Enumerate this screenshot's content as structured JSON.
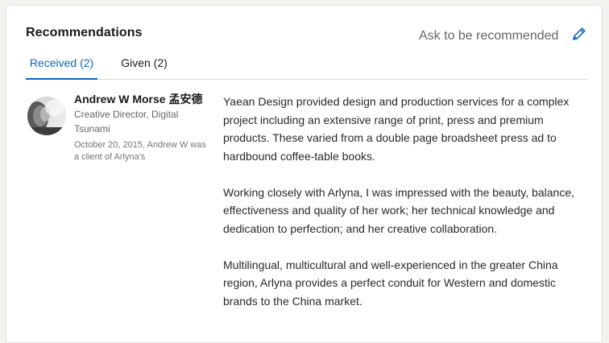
{
  "section": {
    "title": "Recommendations",
    "ask_label": "Ask to be recommended",
    "edit_icon": "pencil-icon",
    "accent_color": "#0a66c2"
  },
  "tabs": [
    {
      "label": "Received (2)",
      "active": true
    },
    {
      "label": "Given (2)",
      "active": false
    }
  ],
  "recommendation": {
    "author_name": "Andrew W Morse 孟安德",
    "author_headline": "Creative Director, Digital Tsunami",
    "meta": "October 20, 2015, Andrew W was a client of Arlyna's",
    "paragraphs": [
      "Yaean Design provided design and production services for a complex project including an extensive range of print, press and premium products. These varied from a double page broadsheet press ad to hardbound coffee-table books.",
      "Working closely with Arlyna, I was impressed with the beauty, balance, effectiveness and quality of her work; her technical knowledge and dedication to perfection; and her creative collaboration.",
      "Multilingual, multicultural and well-experienced in the greater China region, Arlyna provides a perfect conduit for Western and domestic brands to the China market."
    ]
  }
}
